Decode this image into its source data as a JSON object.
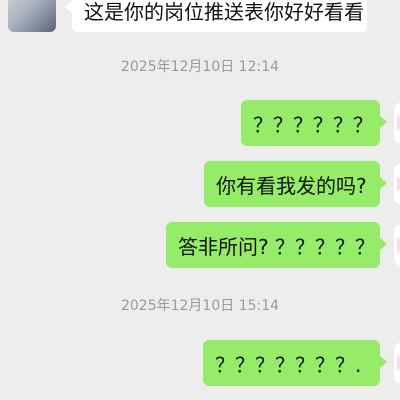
{
  "messages": [
    {
      "text": "这是你的岗位推送表你好好看看"
    },
    {
      "text": "？？？？？？"
    },
    {
      "text": "你有看我发的吗?"
    },
    {
      "text": "答非所问? ？？？？？"
    },
    {
      "text": "？？？？？？？."
    }
  ],
  "timestamps": [
    "2025年12月10日 12:14",
    "2025年12月10日 15:14"
  ],
  "colors": {
    "background": "#ededed",
    "outgoing_bubble": "#95ec69",
    "incoming_bubble": "#ffffff",
    "timestamp_text": "#9a9a9a"
  }
}
